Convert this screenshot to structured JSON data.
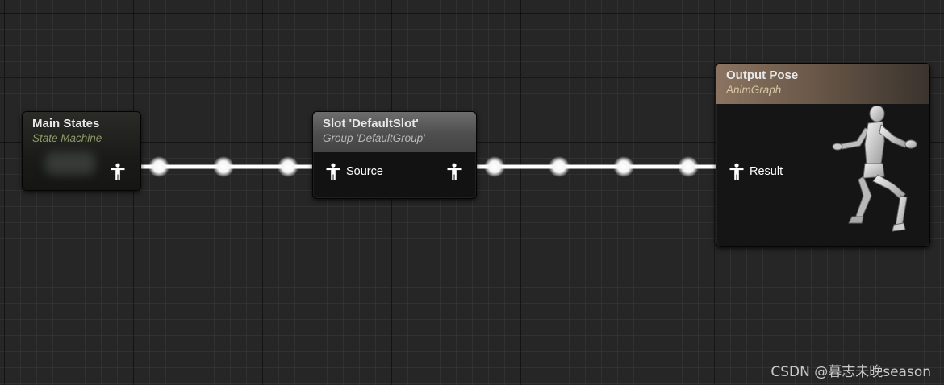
{
  "graph": {
    "nodes": {
      "main_states": {
        "title": "Main States",
        "subtitle": "State Machine"
      },
      "slot": {
        "title": "Slot 'DefaultSlot'",
        "subtitle": "Group 'DefaultGroup'",
        "input_pin_label": "Source"
      },
      "output_pose": {
        "title": "Output Pose",
        "subtitle": "AnimGraph",
        "input_pin_label": "Result"
      }
    },
    "pin_icon": "pose-pin-icon",
    "preview_icon": "running-mannequin-icon"
  },
  "watermark": "CSDN @暮志未晚season",
  "colors": {
    "canvas_background": "#262626",
    "wire": "#ffffff",
    "state_machine_accent": "#8e9a6a",
    "slot_header": "#5c5c5c",
    "output_pose_header": "#8b7361"
  }
}
